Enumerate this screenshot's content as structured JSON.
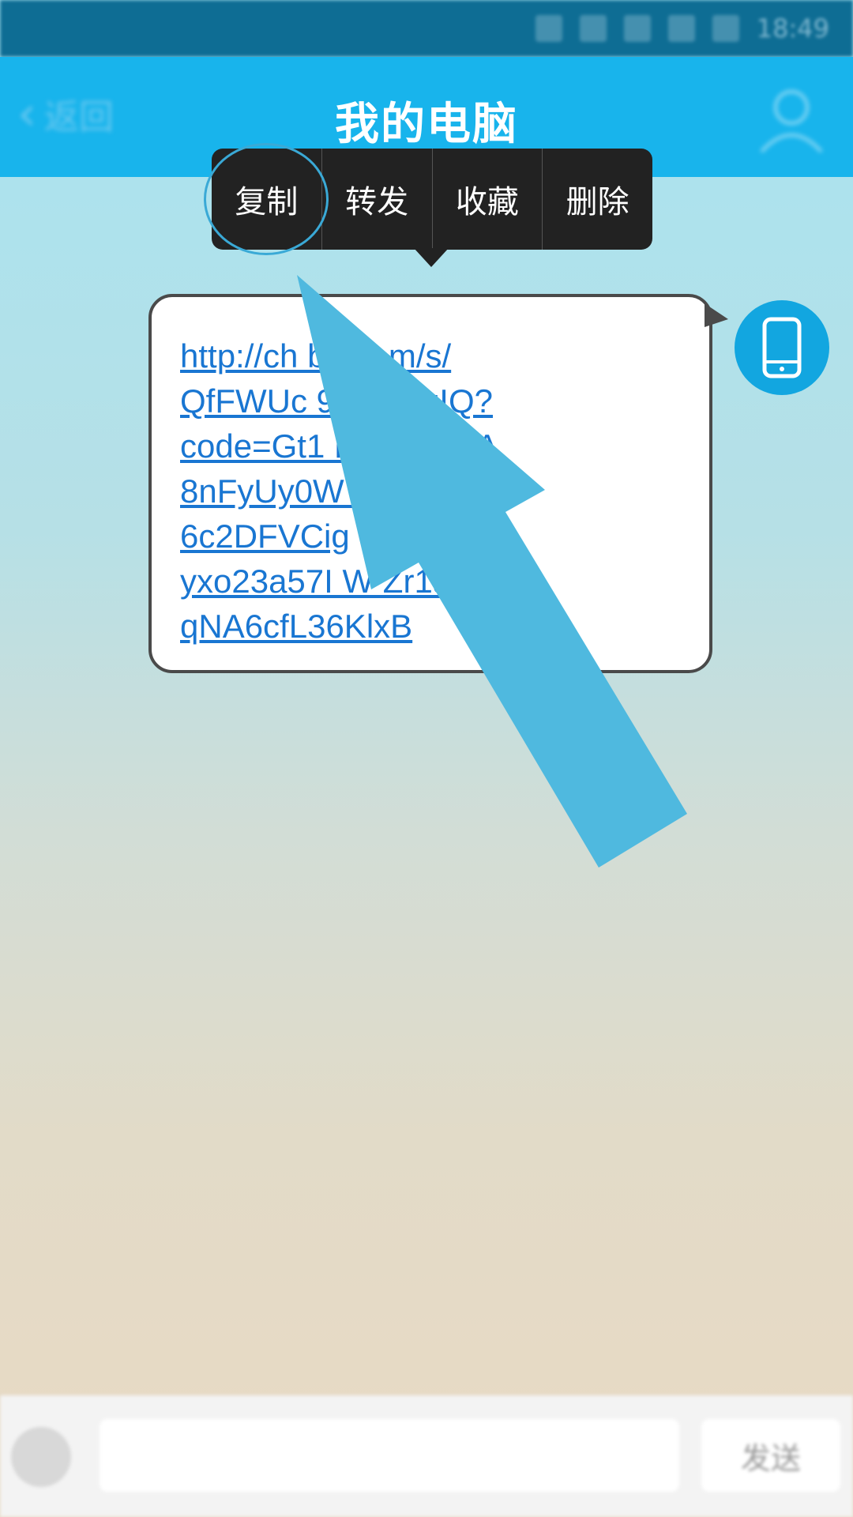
{
  "status_bar": {
    "time": "18:49"
  },
  "header": {
    "back_label": "返回",
    "title": "我的电脑"
  },
  "context_menu": {
    "items": [
      "复制",
      "转发",
      "收藏",
      "删除"
    ]
  },
  "message": {
    "text": "http://c·ba.com/s/QfFWUcJ9JffLJ_zIQ?code=Gt1FZ4aFQeA8nFyUy0WCtfQlp_6c2DFVCigyxo23a57IZr1aXPpqNA6cfL36KlxB",
    "lines": [
      "http://ch      ba.com/s/",
      "QfFWUc        9JffLJ_zIQ?",
      "code=Gt1        FZ4aFQeA",
      "8nFyUy0W         CtfQlp_",
      "6c2DFVCig",
      "yxo23a57I   W      Zr1aXPp",
      "qNA6cfL36KlxB"
    ]
  },
  "input_bar": {
    "send_label": "发送"
  },
  "colors": {
    "title_bar": "#18b4ec",
    "status_bar": "#0e6d94",
    "menu_bg": "#222222",
    "link": "#1976d2",
    "arrow": "#4fb9df",
    "highlight_ring": "#3aa9d6"
  }
}
